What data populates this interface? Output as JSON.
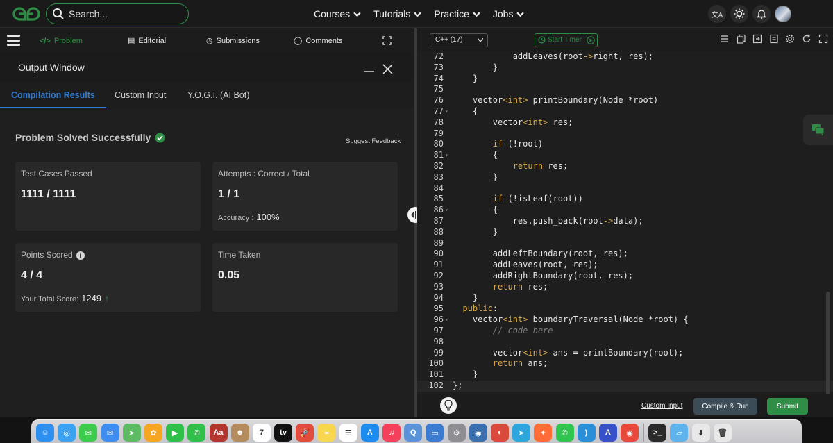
{
  "header": {
    "search": {
      "placeholder": "Search..."
    },
    "nav": [
      {
        "label": "Courses"
      },
      {
        "label": "Tutorials"
      },
      {
        "label": "Practice"
      },
      {
        "label": "Jobs"
      }
    ],
    "icons": [
      "translate-icon",
      "theme-sun-icon",
      "bell-icon",
      "avatar"
    ]
  },
  "problem_tabs": [
    {
      "label": "Problem",
      "icon": "code-icon",
      "active": true
    },
    {
      "label": "Editorial",
      "icon": "document-icon"
    },
    {
      "label": "Submissions",
      "icon": "clock-icon"
    },
    {
      "label": "Comments",
      "icon": "speech-bubble-icon"
    }
  ],
  "output_window": {
    "title": "Output Window",
    "tabs": [
      {
        "label": "Compilation Results",
        "active": true
      },
      {
        "label": "Custom Input"
      },
      {
        "label": "Y.O.G.I. (AI Bot)"
      }
    ],
    "status": "Problem Solved Successfully",
    "feedback_link": "Suggest Feedback",
    "cards": {
      "test_cases": {
        "label": "Test Cases Passed",
        "value": "1111 / 1111"
      },
      "attempts": {
        "label": "Attempts : Correct / Total",
        "value": "1 / 1",
        "sub_label": "Accuracy :",
        "sub_value": "100%"
      },
      "points": {
        "label": "Points Scored",
        "value": "4 / 4",
        "sub_label": "Your Total Score:",
        "sub_value": "1249"
      },
      "time": {
        "label": "Time Taken",
        "value": "0.05"
      }
    }
  },
  "editor": {
    "language": "C++ (17)",
    "timer_label": "Start Timer",
    "toolbar_icons": [
      "list-icon",
      "copy-icon",
      "fullscreen-icon",
      "reset-icon",
      "settings-icon",
      "refresh-icon",
      "expand-icon"
    ],
    "lines": [
      {
        "n": "72",
        "fold": false,
        "code": "            addLeaves(root->right, res);"
      },
      {
        "n": "73",
        "fold": false,
        "code": "        }"
      },
      {
        "n": "74",
        "fold": false,
        "code": "    }"
      },
      {
        "n": "75",
        "fold": false,
        "code": ""
      },
      {
        "n": "76",
        "fold": false,
        "code": "    vector<int> printBoundary(Node *root)"
      },
      {
        "n": "77",
        "fold": true,
        "code": "    {"
      },
      {
        "n": "78",
        "fold": false,
        "code": "        vector<int> res;"
      },
      {
        "n": "79",
        "fold": false,
        "code": ""
      },
      {
        "n": "80",
        "fold": false,
        "code": "        if (!root)"
      },
      {
        "n": "81",
        "fold": true,
        "code": "        {"
      },
      {
        "n": "82",
        "fold": false,
        "code": "            return res;"
      },
      {
        "n": "83",
        "fold": false,
        "code": "        }"
      },
      {
        "n": "84",
        "fold": false,
        "code": ""
      },
      {
        "n": "85",
        "fold": false,
        "code": "        if (!isLeaf(root))"
      },
      {
        "n": "86",
        "fold": true,
        "code": "        {"
      },
      {
        "n": "87",
        "fold": false,
        "code": "            res.push_back(root->data);"
      },
      {
        "n": "88",
        "fold": false,
        "code": "        }"
      },
      {
        "n": "89",
        "fold": false,
        "code": ""
      },
      {
        "n": "90",
        "fold": false,
        "code": "        addLeftBoundary(root, res);"
      },
      {
        "n": "91",
        "fold": false,
        "code": "        addLeaves(root, res);"
      },
      {
        "n": "92",
        "fold": false,
        "code": "        addRightBoundary(root, res);"
      },
      {
        "n": "93",
        "fold": false,
        "code": "        return res;"
      },
      {
        "n": "94",
        "fold": false,
        "code": "    }"
      },
      {
        "n": "95",
        "fold": false,
        "code": "  public:"
      },
      {
        "n": "96",
        "fold": true,
        "code": "    vector<int> boundaryTraversal(Node *root) {"
      },
      {
        "n": "97",
        "fold": false,
        "code": "        // code here"
      },
      {
        "n": "98",
        "fold": false,
        "code": ""
      },
      {
        "n": "99",
        "fold": false,
        "code": "        vector<int> ans = printBoundary(root);"
      },
      {
        "n": "100",
        "fold": false,
        "code": "        return ans;"
      },
      {
        "n": "101",
        "fold": false,
        "code": "    }"
      },
      {
        "n": "102",
        "fold": false,
        "code": "};",
        "current": true
      }
    ]
  },
  "bottom_bar": {
    "custom_input": "Custom Input",
    "compile_run": "Compile & Run",
    "submit": "Submit"
  },
  "dock": {
    "apps": [
      {
        "name": "finder-icon",
        "color": "#2d8ff0",
        "glyph": "☺"
      },
      {
        "name": "safari-icon",
        "color": "#3aa2f0",
        "glyph": "◎"
      },
      {
        "name": "messages-icon",
        "color": "#3ccb4d",
        "glyph": "✉"
      },
      {
        "name": "mail-icon",
        "color": "#3d8ef0",
        "glyph": "✉"
      },
      {
        "name": "maps-icon",
        "color": "#5dbb63",
        "glyph": "➤"
      },
      {
        "name": "photos-icon",
        "color": "#f5a623",
        "glyph": "✿"
      },
      {
        "name": "facetime-icon",
        "color": "#2fc04a",
        "glyph": "▶"
      },
      {
        "name": "phone-icon",
        "color": "#30c04a",
        "glyph": "✆"
      },
      {
        "name": "dictionary-icon",
        "color": "#b2352e",
        "glyph": "Aa"
      },
      {
        "name": "contacts-icon",
        "color": "#b58c5e",
        "glyph": "☻"
      },
      {
        "name": "calendar-icon",
        "color": "#ffffff",
        "glyph": "7",
        "dark": true
      },
      {
        "name": "tv-icon",
        "color": "#111111",
        "glyph": "tv"
      },
      {
        "name": "launchpad-icon",
        "color": "#e24c3c",
        "glyph": "🚀"
      },
      {
        "name": "notes-icon",
        "color": "#f8d64e",
        "glyph": "≡"
      },
      {
        "name": "reminders-icon",
        "color": "#ffffff",
        "glyph": "☰",
        "dark": true
      },
      {
        "name": "appstore-icon",
        "color": "#1d8cf0",
        "glyph": "A"
      },
      {
        "name": "music-icon",
        "color": "#f4405a",
        "glyph": "♫"
      },
      {
        "name": "quicktime-icon",
        "color": "#5a93d8",
        "glyph": "Q"
      },
      {
        "name": "preview-icon",
        "color": "#3b7bd0",
        "glyph": "▭"
      },
      {
        "name": "settings-icon",
        "color": "#8e8e93",
        "glyph": "⚙"
      },
      {
        "name": "database-icon",
        "color": "#3a6fb0",
        "glyph": "◉"
      },
      {
        "name": "chrome-alt-icon",
        "color": "#d94a3c",
        "glyph": "◐"
      },
      {
        "name": "telegram-icon",
        "color": "#2ea6dd",
        "glyph": "➤"
      },
      {
        "name": "postman-icon",
        "color": "#ff6c37",
        "glyph": "✦"
      },
      {
        "name": "whatsapp-icon",
        "color": "#2fc54f",
        "glyph": "✆"
      },
      {
        "name": "vscode-icon",
        "color": "#2b8fd8",
        "glyph": "⟩"
      },
      {
        "name": "arc-icon",
        "color": "#3752c9",
        "glyph": "A"
      },
      {
        "name": "chrome-icon",
        "color": "#e9493a",
        "glyph": "◉"
      },
      {
        "name": "terminal-icon",
        "color": "#2a2a2a",
        "glyph": ">_"
      },
      {
        "name": "folder-icon",
        "color": "#5fb3ec",
        "glyph": "▱"
      },
      {
        "name": "downloads-icon",
        "color": "#e8e8e8",
        "glyph": "⬇",
        "dark": true
      },
      {
        "name": "trash-icon",
        "color": "#e8e8e8",
        "glyph": "🗑",
        "dark": true
      }
    ]
  }
}
